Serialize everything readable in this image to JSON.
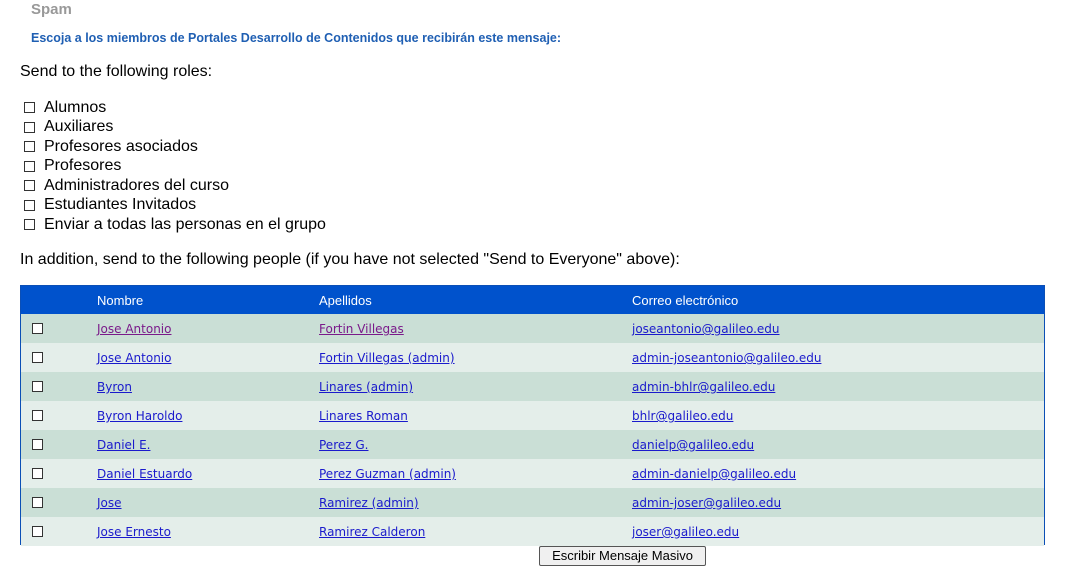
{
  "page_title": "Spam",
  "instruction": "Escoja a los miembros de Portales Desarrollo de Contenidos que recibirán este mensaje:",
  "roles_heading": "Send to the following roles:",
  "roles": [
    {
      "label": "Alumnos",
      "checked": false
    },
    {
      "label": "Auxiliares",
      "checked": false
    },
    {
      "label": "Profesores asociados",
      "checked": false
    },
    {
      "label": "Profesores",
      "checked": false
    },
    {
      "label": "Administradores del curso",
      "checked": false
    },
    {
      "label": "Estudiantes Invitados",
      "checked": false
    },
    {
      "label": "Enviar a todas las personas en el grupo",
      "checked": false
    }
  ],
  "people_heading": "In addition, send to the following people (if you have not selected \"Send to Everyone\" above):",
  "table": {
    "columns": [
      "Nombre",
      "Apellidos",
      "Correo electrónico"
    ],
    "rows": [
      {
        "nombre": "Jose Antonio",
        "apellidos": "Fortin Villegas",
        "correo": "joseantonio@galileo.edu"
      },
      {
        "nombre": "Jose Antonio",
        "apellidos": "Fortin Villegas (admin)",
        "correo": "admin-joseantonio@galileo.edu"
      },
      {
        "nombre": "Byron",
        "apellidos": "Linares (admin)",
        "correo": "admin-bhlr@galileo.edu"
      },
      {
        "nombre": "Byron Haroldo",
        "apellidos": "Linares Roman",
        "correo": "bhlr@galileo.edu"
      },
      {
        "nombre": "Daniel E.",
        "apellidos": "Perez G.",
        "correo": "danielp@galileo.edu"
      },
      {
        "nombre": "Daniel Estuardo",
        "apellidos": "Perez Guzman (admin)",
        "correo": "admin-danielp@galileo.edu"
      },
      {
        "nombre": "Jose",
        "apellidos": "Ramirez (admin)",
        "correo": "admin-joser@galileo.edu"
      },
      {
        "nombre": "Jose Ernesto",
        "apellidos": "Ramirez Calderon",
        "correo": "joser@galileo.edu"
      }
    ]
  },
  "send_button_label": "Escribir Mensaje Masivo",
  "colors": {
    "header_bg": "#0052cc",
    "row_odd": "#cadfd6",
    "row_even": "#e4eeea",
    "link": "#1a1acc",
    "link_visited": "#7a1a8a",
    "instruction": "#1f5fb3"
  }
}
